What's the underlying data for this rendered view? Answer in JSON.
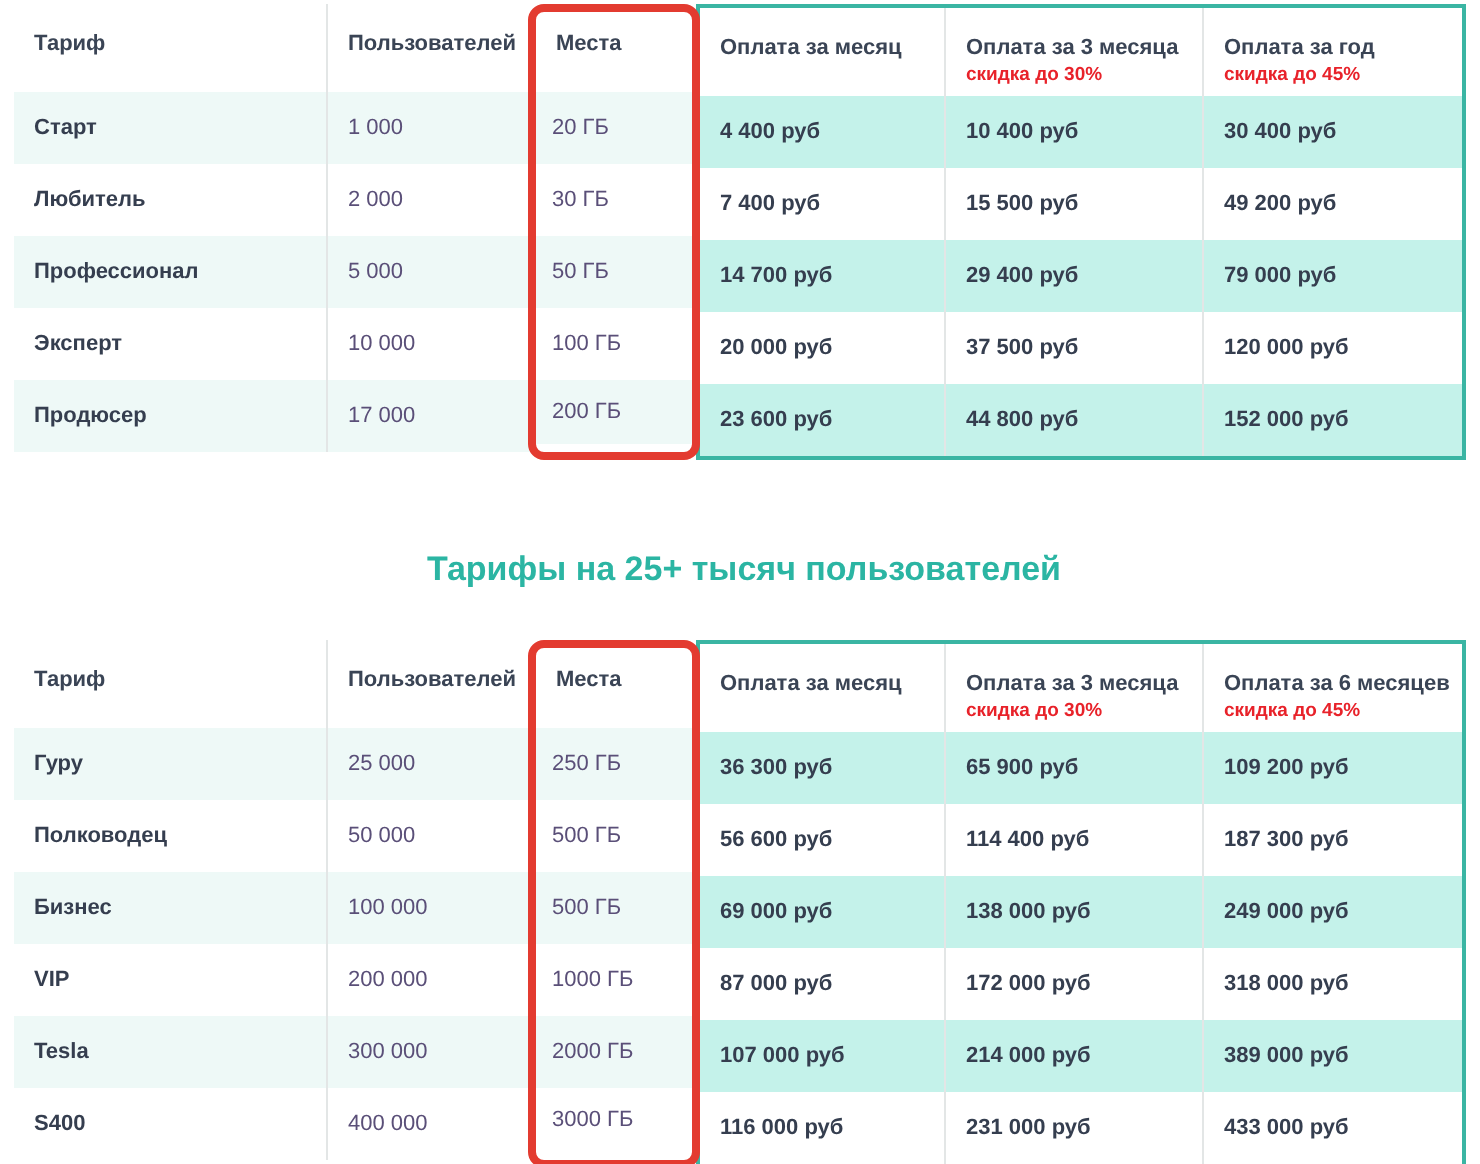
{
  "tables": [
    {
      "columns": [
        {
          "label": "Тариф",
          "kind": "name",
          "highlighted": false,
          "cells": [
            "Старт",
            "Любитель",
            "Профессионал",
            "Эксперт",
            "Продюсер"
          ]
        },
        {
          "label": "Пользователей",
          "kind": "plain",
          "highlighted": false,
          "cells": [
            "1 000",
            "2 000",
            "5 000",
            "10 000",
            "17 000"
          ]
        },
        {
          "label": "Места",
          "kind": "plain",
          "highlighted": true,
          "cells": [
            "20 ГБ",
            "30 ГБ",
            "50 ГБ",
            "100 ГБ",
            "200 ГБ"
          ]
        },
        {
          "label": "Оплата за месяц",
          "kind": "price",
          "highlighted": false,
          "cells": [
            "4 400 руб",
            "7 400 руб",
            "14 700 руб",
            "20 000 руб",
            "23 600 руб"
          ]
        },
        {
          "label": "Оплата за 3 месяца",
          "note": "скидка до 30%",
          "kind": "price",
          "highlighted": false,
          "cells": [
            "10 400 руб",
            "15 500 руб",
            "29 400 руб",
            "37 500 руб",
            "44 800 руб"
          ]
        },
        {
          "label": "Оплата за год",
          "note": "скидка до 45%",
          "kind": "price",
          "highlighted": false,
          "cells": [
            "30 400 руб",
            "49 200 руб",
            "79 000 руб",
            "120 000 руб",
            "152 000 руб"
          ]
        }
      ]
    },
    {
      "title": "Тарифы на 25+ тысяч пользователей",
      "columns": [
        {
          "label": "Тариф",
          "kind": "name",
          "highlighted": false,
          "cells": [
            "Гуру",
            "Полководец",
            "Бизнес",
            "VIP",
            "Tesla",
            "S400"
          ]
        },
        {
          "label": "Пользователей",
          "kind": "plain",
          "highlighted": false,
          "cells": [
            "25 000",
            "50 000",
            "100 000",
            "200 000",
            "300 000",
            "400 000"
          ]
        },
        {
          "label": "Места",
          "kind": "plain",
          "highlighted": true,
          "cells": [
            "250 ГБ",
            "500 ГБ",
            "500 ГБ",
            "1000 ГБ",
            "2000 ГБ",
            "3000 ГБ"
          ]
        },
        {
          "label": "Оплата за месяц",
          "kind": "price",
          "highlighted": false,
          "cells": [
            "36 300 руб",
            "56 600 руб",
            "69 000 руб",
            "87 000 руб",
            "107 000 руб",
            "116 000 руб"
          ]
        },
        {
          "label": "Оплата за 3 месяца",
          "note": "скидка до 30%",
          "kind": "price",
          "highlighted": false,
          "cells": [
            "65 900 руб",
            "114 400 руб",
            "138 000 руб",
            "172 000 руб",
            "214 000 руб",
            "231 000 руб"
          ]
        },
        {
          "label": "Оплата за 6 месяцев",
          "note": "скидка до 45%",
          "kind": "price",
          "highlighted": false,
          "cells": [
            "109 200 руб",
            "187 300 руб",
            "249 000 руб",
            "318 000 руб",
            "389 000 руб",
            "433 000 руб"
          ]
        }
      ]
    }
  ]
}
